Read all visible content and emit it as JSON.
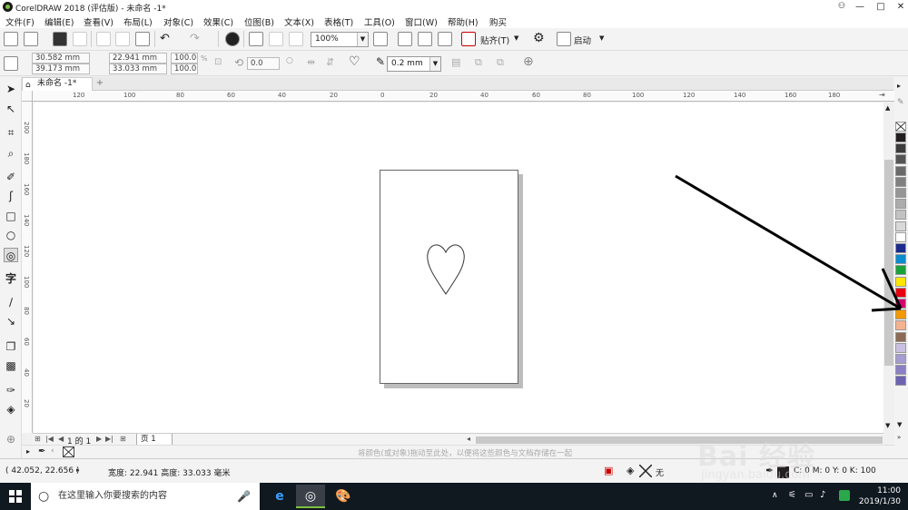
{
  "window": {
    "title": "CorelDRAW 2018 (评估版) - 未命名 -1*",
    "min": "—",
    "max": "□",
    "close": "✕"
  },
  "menu": [
    "文件(F)",
    "编辑(E)",
    "查看(V)",
    "布局(L)",
    "对象(C)",
    "效果(C)",
    "位图(B)",
    "文本(X)",
    "表格(T)",
    "工具(O)",
    "窗口(W)",
    "帮助(H)",
    "购买"
  ],
  "toolbar": {
    "zoom": "100%",
    "paste": "贴齐(T)",
    "launch": "启动"
  },
  "property_bar": {
    "x": "30.582 mm",
    "y": "39.173 mm",
    "width": "22.941 mm",
    "height": "33.033 mm",
    "scale_x": "100.0",
    "scale_y": "100.0",
    "percent": "%",
    "rotation": "0.0",
    "outline_width": "0.2 mm"
  },
  "document_tab": "未命名 -1*",
  "ruler_top_labels": [
    "120",
    "100",
    "80",
    "60",
    "40",
    "20",
    "0",
    "20",
    "40",
    "60",
    "80",
    "100",
    "120",
    "140",
    "160",
    "180"
  ],
  "ruler_left_labels": [
    "200",
    "180",
    "160",
    "140",
    "120",
    "100",
    "80",
    "60",
    "40",
    "20"
  ],
  "page_nav": {
    "page_count": "1 的 1",
    "page_tab": "页 1"
  },
  "palette_hint": "将颜色(或对象)拖动至此处，以便将这些颜色与文档存储在一起",
  "status": {
    "coords": "( 42.052, 22.656 )",
    "size": "宽度: 22.941  高度: 33.033  毫米",
    "fill": "无",
    "color": "C: 0 M: 0 Y: 0 K: 100"
  },
  "taskbar": {
    "search": "在这里输入你要搜索的内容",
    "time": "11:00",
    "date": "2019/1/30"
  },
  "watermark": {
    "logo": "Bai 经验",
    "url": "jingyan.baidu.com"
  },
  "palette_colors": [
    "#231f20",
    "#3c3c3c",
    "#545454",
    "#6a6a6a",
    "#808080",
    "#969696",
    "#acacac",
    "#c2c2c2",
    "#d8d8d8",
    "#ffffff",
    "#1b2c8f",
    "#0a8ccf",
    "#1aa23a",
    "#ffe600",
    "#e60012",
    "#d4006e",
    "#f39800",
    "#f6b18f",
    "#8c6a55",
    "#c9c0e0",
    "#a59cd0",
    "#8b80c4",
    "#6d62b2"
  ]
}
